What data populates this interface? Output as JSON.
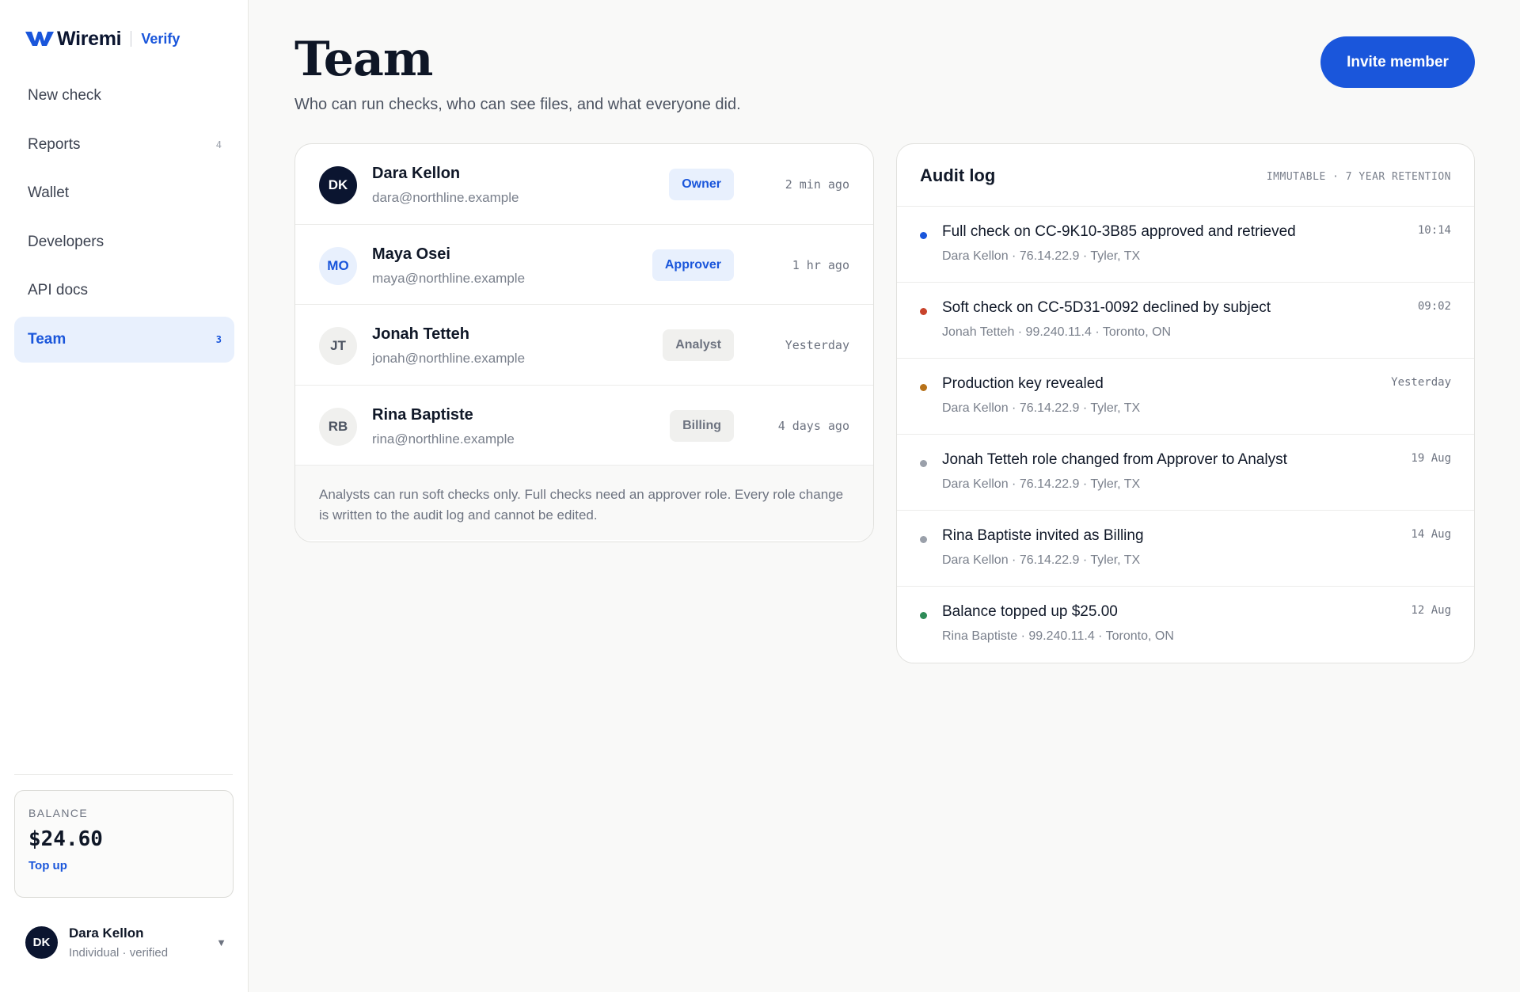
{
  "brand": {
    "name": "Wiremi",
    "product": "Verify"
  },
  "nav": [
    {
      "label": "New check",
      "count": "",
      "active": false
    },
    {
      "label": "Reports",
      "count": "4",
      "active": false
    },
    {
      "label": "Wallet",
      "count": "",
      "active": false
    },
    {
      "label": "Developers",
      "count": "",
      "active": false
    },
    {
      "label": "API docs",
      "count": "",
      "active": false
    },
    {
      "label": "Team",
      "count": "3",
      "active": true
    }
  ],
  "balance": {
    "label": "BALANCE",
    "value": "$24.60",
    "topup_label": "Top up"
  },
  "current_user": {
    "initials": "DK",
    "name": "Dara Kellon",
    "subtitle": "Individual · verified"
  },
  "page": {
    "title": "Team",
    "subtitle": "Who can run checks, who can see files, and what everyone did.",
    "invite_label": "Invite member"
  },
  "members": [
    {
      "initials": "DK",
      "name": "Dara Kellon",
      "email": "dara@northline.example",
      "role": "Owner",
      "role_style": "owner",
      "time": "2 min ago",
      "avatar_bg": "#0b1530",
      "avatar_fg": "#ffffff"
    },
    {
      "initials": "MO",
      "name": "Maya Osei",
      "email": "maya@northline.example",
      "role": "Approver",
      "role_style": "approver",
      "time": "1 hr ago",
      "avatar_bg": "#e8f0fd",
      "avatar_fg": "#1a56db"
    },
    {
      "initials": "JT",
      "name": "Jonah Tetteh",
      "email": "jonah@northline.example",
      "role": "Analyst",
      "role_style": "analyst",
      "time": "Yesterday",
      "avatar_bg": "#f0f0ee",
      "avatar_fg": "#4d5462"
    },
    {
      "initials": "RB",
      "name": "Rina Baptiste",
      "email": "rina@northline.example",
      "role": "Billing",
      "role_style": "billing",
      "time": "4 days ago",
      "avatar_bg": "#f0f0ee",
      "avatar_fg": "#4d5462"
    }
  ],
  "members_note": "Analysts can run soft checks only. Full checks need an approver role. Every role change is written to the audit log and cannot be edited.",
  "audit": {
    "title": "Audit log",
    "tag": "IMMUTABLE · 7 YEAR RETENTION",
    "entries": [
      {
        "text": "Full check on CC-9K10-3B85 approved and retrieved",
        "meta": "Dara Kellon · 76.14.22.9 · Tyler, TX",
        "time": "10:14",
        "dot_color": "#1a56db"
      },
      {
        "text": "Soft check on CC-5D31-0092 declined by subject",
        "meta": "Jonah Tetteh · 99.240.11.4 · Toronto, ON",
        "time": "09:02",
        "dot_color": "#c8432b"
      },
      {
        "text": "Production key revealed",
        "meta": "Dara Kellon · 76.14.22.9 · Tyler, TX",
        "time": "Yesterday",
        "dot_color": "#b7721a"
      },
      {
        "text": "Jonah Tetteh role changed from Approver to Analyst",
        "meta": "Dara Kellon · 76.14.22.9 · Tyler, TX",
        "time": "19 Aug",
        "dot_color": "#9aa0aa"
      },
      {
        "text": "Rina Baptiste invited as Billing",
        "meta": "Dara Kellon · 76.14.22.9 · Tyler, TX",
        "time": "14 Aug",
        "dot_color": "#9aa0aa"
      },
      {
        "text": "Balance topped up $25.00",
        "meta": "Rina Baptiste · 99.240.11.4 · Toronto, ON",
        "time": "12 Aug",
        "dot_color": "#2e8b57"
      }
    ]
  },
  "icons": {
    "brand_logo": "wiremi-logo-icon",
    "chevron": "chevron-down-icon"
  }
}
